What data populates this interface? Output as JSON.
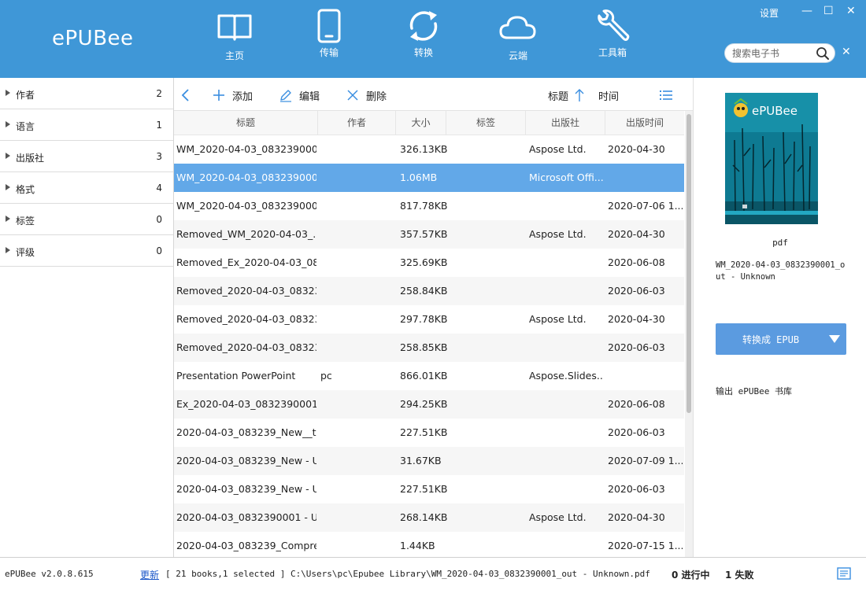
{
  "app": {
    "logo": "ePUBee"
  },
  "window": {
    "settings": "设置",
    "minimize": "—",
    "maximize": "☐",
    "close": "✕"
  },
  "nav": [
    {
      "id": "home",
      "label": "主页",
      "icon": "book-icon"
    },
    {
      "id": "transfer",
      "label": "传输",
      "icon": "phone-icon"
    },
    {
      "id": "convert",
      "label": "转换",
      "icon": "sync-icon"
    },
    {
      "id": "cloud",
      "label": "云端",
      "icon": "cloud-icon"
    },
    {
      "id": "tools",
      "label": "工具箱",
      "icon": "wrench-icon"
    }
  ],
  "search": {
    "placeholder": "搜索电子书",
    "clear": "✕"
  },
  "sidebar": {
    "items": [
      {
        "label": "作者",
        "count": "2"
      },
      {
        "label": "语言",
        "count": "1"
      },
      {
        "label": "出版社",
        "count": "3"
      },
      {
        "label": "格式",
        "count": "4"
      },
      {
        "label": "标签",
        "count": "0"
      },
      {
        "label": "评级",
        "count": "0"
      }
    ]
  },
  "toolbar": {
    "add": "添加",
    "edit": "编辑",
    "delete": "删除",
    "sort_title": "标题",
    "sort_time": "时间"
  },
  "table": {
    "columns": [
      "标题",
      "作者",
      "大小",
      "标签",
      "出版社",
      "出版时间"
    ],
    "rows": [
      {
        "title": "WM_2020-04-03_083239000...",
        "author": "",
        "size": "326.13KB",
        "tags": "",
        "publisher": "Aspose Ltd.",
        "date": "2020-04-30"
      },
      {
        "title": "WM_2020-04-03_083239000...",
        "author": "",
        "size": "1.06MB",
        "tags": "",
        "publisher": "Microsoft Offi...",
        "date": ""
      },
      {
        "title": "WM_2020-04-03_083239000...",
        "author": "",
        "size": "817.78KB",
        "tags": "",
        "publisher": "",
        "date": "2020-07-06 1..."
      },
      {
        "title": "Removed_WM_2020-04-03_...",
        "author": "",
        "size": "357.57KB",
        "tags": "",
        "publisher": "Aspose Ltd.",
        "date": "2020-04-30"
      },
      {
        "title": "Removed_Ex_2020-04-03_08...",
        "author": "",
        "size": "325.69KB",
        "tags": "",
        "publisher": "",
        "date": "2020-06-08"
      },
      {
        "title": "Removed_2020-04-03_08323...",
        "author": "",
        "size": "258.84KB",
        "tags": "",
        "publisher": "",
        "date": "2020-06-03"
      },
      {
        "title": "Removed_2020-04-03_08323...",
        "author": "",
        "size": "297.78KB",
        "tags": "",
        "publisher": "Aspose Ltd.",
        "date": "2020-04-30"
      },
      {
        "title": "Removed_2020-04-03_08323...",
        "author": "",
        "size": "258.85KB",
        "tags": "",
        "publisher": "",
        "date": "2020-06-03"
      },
      {
        "title": "Presentation PowerPoint",
        "author": "pc",
        "size": "866.01KB",
        "tags": "",
        "publisher": "Aspose.Slides...",
        "date": ""
      },
      {
        "title": "Ex_2020-04-03_0832390001 ...",
        "author": "",
        "size": "294.25KB",
        "tags": "",
        "publisher": "",
        "date": "2020-06-08"
      },
      {
        "title": "2020-04-03_083239_New__t...",
        "author": "",
        "size": "227.51KB",
        "tags": "",
        "publisher": "",
        "date": "2020-06-03"
      },
      {
        "title": "2020-04-03_083239_New - U...",
        "author": "",
        "size": "31.67KB",
        "tags": "",
        "publisher": "",
        "date": "2020-07-09 1..."
      },
      {
        "title": "2020-04-03_083239_New - U...",
        "author": "",
        "size": "227.51KB",
        "tags": "",
        "publisher": "",
        "date": "2020-06-03"
      },
      {
        "title": "2020-04-03_0832390001 - U...",
        "author": "",
        "size": "268.14KB",
        "tags": "",
        "publisher": "Aspose Ltd.",
        "date": "2020-04-30"
      },
      {
        "title": "2020-04-03_083239_Compre...",
        "author": "",
        "size": "1.44KB",
        "tags": "",
        "publisher": "",
        "date": "2020-07-15 1..."
      }
    ],
    "selected_index": 1
  },
  "detail": {
    "cover_brand": "ePUBee",
    "format": "pdf",
    "file_name": "WM_2020-04-03_0832390001_out - Unknown",
    "convert_label": "转换成 EPUB",
    "output": "输出 ePUBee 书库"
  },
  "status": {
    "version": "ePUBee v2.0.8.615",
    "update": "更新",
    "info": "[ 21 books,1 selected ] C:\\Users\\pc\\Epubee Library\\WM_2020-04-03_0832390001_out - Unknown.pdf",
    "in_progress": "0 进行中",
    "failed": "1 失败"
  },
  "colors": {
    "header": "#3f97d7",
    "selected_row": "#62a8e8",
    "button": "#5b9be0"
  }
}
